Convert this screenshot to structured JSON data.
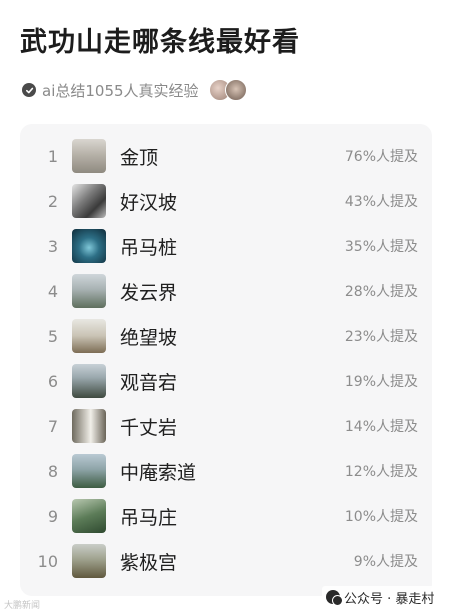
{
  "title": "武功山走哪条线最好看",
  "summary": {
    "text": "ai总结1055人真实经验",
    "icon": "check-icon"
  },
  "list": [
    {
      "rank": "1",
      "name": "金顶",
      "percent": "76%人提及",
      "thumb": "summit-photo"
    },
    {
      "rank": "2",
      "name": "好汉坡",
      "percent": "43%人提及",
      "thumb": "slope-photo"
    },
    {
      "rank": "3",
      "name": "吊马桩",
      "percent": "35%人提及",
      "thumb": "cave-photo"
    },
    {
      "rank": "4",
      "name": "发云界",
      "percent": "28%人提及",
      "thumb": "ridge-photo"
    },
    {
      "rank": "5",
      "name": "绝望坡",
      "percent": "23%人提及",
      "thumb": "trail-photo"
    },
    {
      "rank": "6",
      "name": "观音宕",
      "percent": "19%人提及",
      "thumb": "mountain-photo"
    },
    {
      "rank": "7",
      "name": "千丈岩",
      "percent": "14%人提及",
      "thumb": "waterfall-photo"
    },
    {
      "rank": "8",
      "name": "中庵索道",
      "percent": "12%人提及",
      "thumb": "cableway-photo"
    },
    {
      "rank": "9",
      "name": "吊马庄",
      "percent": "10%人提及",
      "thumb": "valley-photo"
    },
    {
      "rank": "10",
      "name": "紫极宫",
      "percent": "9%人提及",
      "thumb": "temple-photo"
    }
  ],
  "watermark": {
    "left": "大鹏新闻",
    "right": "公众号 · 暴走村"
  },
  "colors": {
    "card_background": "#f6f6f7",
    "muted_text": "#8c8c8c",
    "primary_text": "#202020"
  }
}
